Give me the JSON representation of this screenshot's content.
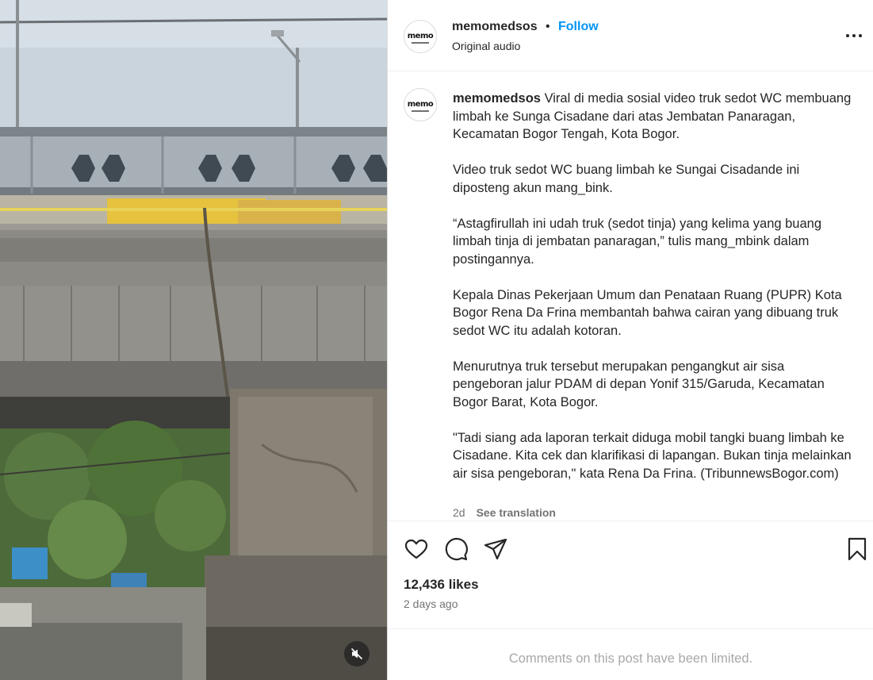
{
  "post": {
    "username": "memomedsos",
    "follow_label": "Follow",
    "separator": "•",
    "audio_label": "Original audio",
    "avatar_text": "memo",
    "caption": "Viral di media sosial video truk sedot WC membuang limbah ke Sunga Cisadane dari atas Jembatan Panaragan, Kecamatan Bogor Tengah, Kota Bogor.\n\nVideo truk sedot WC buang limbah ke Sungai Cisadande ini diposteng akun mang_bink.\n\n“Astagfirullah ini udah truk (sedot tinja) yang kelima yang buang limbah tinja di jembatan panaragan,” tulis mang_mbink dalam postingannya.\n\nKepala Dinas Pekerjaan Umum dan Penataan Ruang (PUPR) Kota Bogor Rena Da Frina membantah bahwa cairan yang dibuang truk sedot WC itu adalah kotoran.\n\nMenurutnya truk tersebut merupakan pengangkut air sisa pengeboran jalur PDAM di depan Yonif 315/Garuda, Kecamatan Bogor Barat, Kota Bogor.\n\n\"Tadi siang ada laporan terkait diduga mobil tangki buang limbah ke Cisadane. Kita cek dan klarifikasi di lapangan. Bukan tinja melainkan air sisa pengeboran,\" kata Rena Da Frina. (TribunnewsBogor.com)",
    "caption_age": "2d",
    "see_translation_label": "See translation",
    "likes": "12,436 likes",
    "time_ago": "2 days ago",
    "comments_limited": "Comments on this post have been limited."
  },
  "icons": {
    "more": "more-horizontal-icon",
    "like": "heart-icon",
    "comment": "comment-icon",
    "share": "send-icon",
    "save": "bookmark-icon",
    "mute": "muted-speaker-icon"
  },
  "colors": {
    "accent": "#0095f6",
    "text": "#262626",
    "secondary": "#737373",
    "muted": "#a8a8a8",
    "border": "#dbdbdb"
  }
}
